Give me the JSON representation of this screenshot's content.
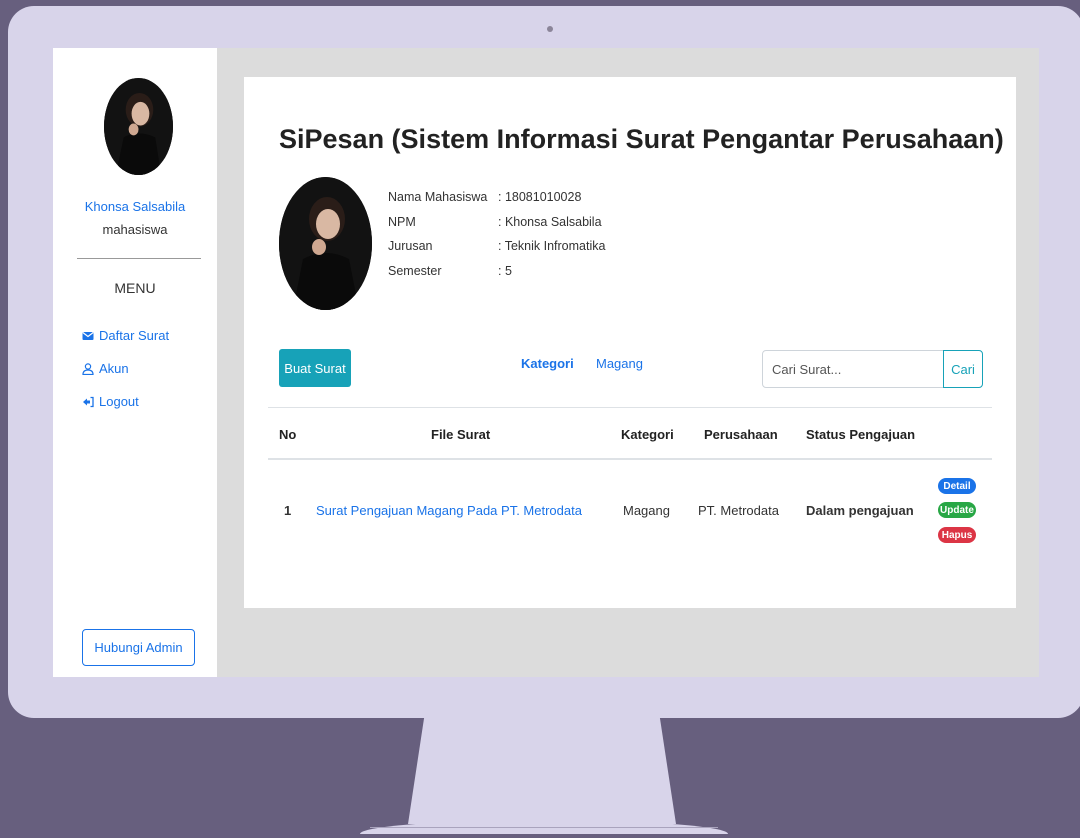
{
  "sidebar": {
    "user_name": "Khonsa Salsabila",
    "user_role": "mahasiswa",
    "menu_label": "MENU",
    "items": [
      {
        "label": "Daftar Surat",
        "icon": "envelope-icon"
      },
      {
        "label": "Akun",
        "icon": "user-icon"
      },
      {
        "label": "Logout",
        "icon": "logout-icon"
      }
    ],
    "contact_button": "Hubungi Admin"
  },
  "main": {
    "title": "SiPesan (Sistem Informasi Surat Pengantar Perusahaan)",
    "profile": [
      {
        "key": "Nama Mahasiswa",
        "value": ": 18081010028"
      },
      {
        "key": "NPM",
        "value": ": Khonsa Salsabila"
      },
      {
        "key": "Jurusan",
        "value": ": Teknik Infromatika"
      },
      {
        "key": "Semester",
        "value": ": 5"
      }
    ],
    "create_button": "Buat Surat",
    "tabs": [
      "Kategori",
      "Magang"
    ],
    "search": {
      "placeholder": "Cari Surat...",
      "button": "Cari"
    },
    "table": {
      "headers": [
        "No",
        "File Surat",
        "Kategori",
        "Perusahaan",
        "Status Pengajuan"
      ],
      "rows": [
        {
          "no": "1",
          "file": "Surat Pengajuan Magang Pada PT. Metrodata",
          "kategori": "Magang",
          "perusahaan": "PT. Metrodata",
          "status": "Dalam pengajuan",
          "actions": [
            "Detail",
            "Update",
            "Hapus"
          ]
        }
      ]
    }
  },
  "colors": {
    "background": "#675f7e",
    "monitor": "#d8d4ea",
    "link": "#1a73e8",
    "info": "#17a2b8",
    "success": "#28a745",
    "danger": "#dc3545"
  }
}
